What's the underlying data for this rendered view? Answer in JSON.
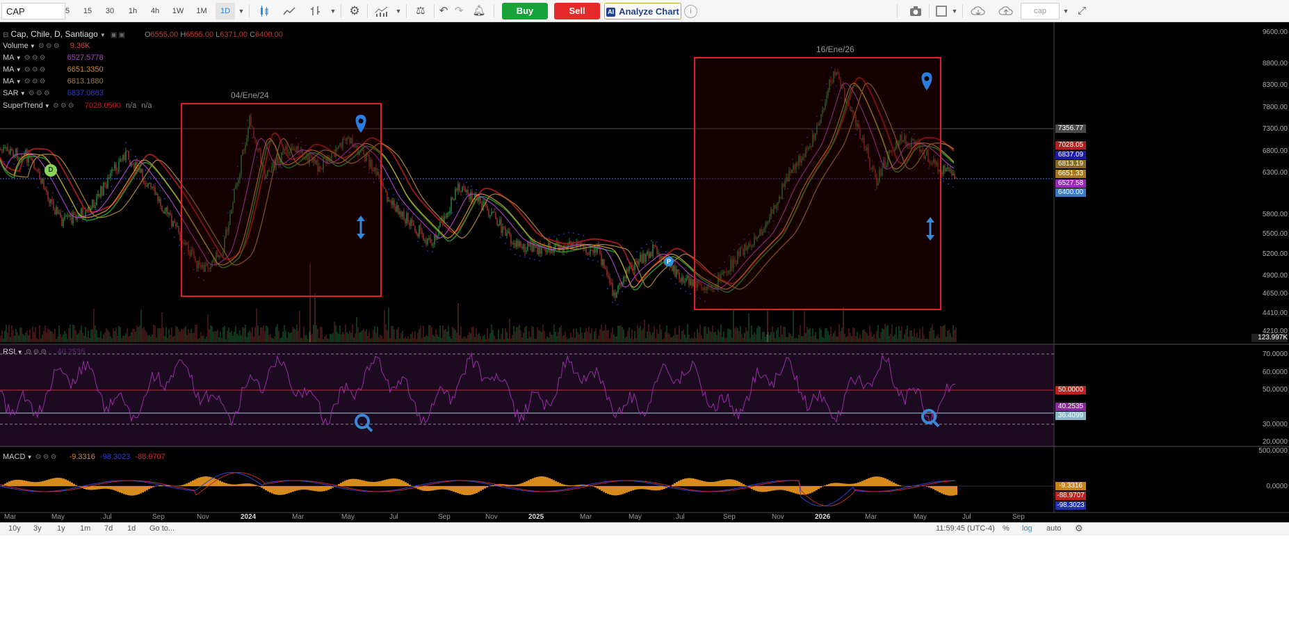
{
  "toolbar": {
    "symbol": "CAP",
    "intervals": [
      "5",
      "15",
      "30",
      "1h",
      "4h",
      "1W",
      "1M",
      "1D"
    ],
    "active_interval": "1D",
    "buy_label": "Buy",
    "sell_label": "Sell",
    "analyze_label": "Analyze Chart",
    "ai_badge": "AI",
    "search_placeholder": "cap",
    "info_icon": "i"
  },
  "legend": {
    "main": {
      "name": "Cap, Chile, D, Santiago",
      "o_label": "O",
      "o": "6555.00",
      "h_label": "H",
      "h": "6555.00",
      "l_label": "L",
      "l": "6371.00",
      "c_label": "C",
      "c": "6400.00"
    },
    "volume": {
      "name": "Volume",
      "value": "9.36K"
    },
    "ma1": {
      "name": "MA",
      "value": "6527.5778"
    },
    "ma2": {
      "name": "MA",
      "value": "6651.3350"
    },
    "ma3": {
      "name": "MA",
      "value": "6813.1880"
    },
    "sar": {
      "name": "SAR",
      "value": "6837.0883"
    },
    "supertrend": {
      "name": "SuperTrend",
      "value": "7028.0500",
      "v2": "n/a",
      "v3": "n/a"
    },
    "rsi": {
      "name": "RSI",
      "value": "40.2535"
    },
    "macd": {
      "name": "MACD",
      "v1": "-9.3316",
      "v2": "-98.3023",
      "v3": "-88.9707"
    }
  },
  "annotations": {
    "box1_date": "04/Ene/24",
    "box2_date": "16/Ene/26",
    "marker_d": "D",
    "marker_p": "P"
  },
  "price_axis": [
    "9600.00",
    "8800.00",
    "8300.00",
    "7800.00",
    "7300.00",
    "6800.00",
    "6300.00",
    "5800.00",
    "5500.00",
    "5200.00",
    "4900.00",
    "4650.00",
    "4410.00",
    "4210.00"
  ],
  "price_tags": [
    {
      "text": "7356.77",
      "color": "#4a4a4a"
    },
    {
      "text": "7028.05",
      "color": "#b02020"
    },
    {
      "text": "6837.09",
      "color": "#1c1ca8"
    },
    {
      "text": "6813.19",
      "color": "#8a6a22"
    },
    {
      "text": "6651.33",
      "color": "#a8781e"
    },
    {
      "text": "6527.58",
      "color": "#9a2ab0"
    },
    {
      "text": "6400.00",
      "color": "#3a78c8"
    }
  ],
  "volume_tag": "123.997K",
  "rsi_axis": [
    "70.0000",
    "60.0000",
    "50.0000",
    "30.0000",
    "20.0000"
  ],
  "rsi_tags": [
    {
      "text": "50.0000",
      "color": "#c02020"
    },
    {
      "text": "40.2535",
      "color": "#8a2a9a"
    },
    {
      "text": "36.4099",
      "color": "#8ab8c8"
    }
  ],
  "macd_axis": [
    "500.0000",
    "0.0000"
  ],
  "macd_tags": [
    {
      "text": "-9.3316",
      "color": "#c8821c"
    },
    {
      "text": "-88.9707",
      "color": "#c02020"
    },
    {
      "text": "-98.3023",
      "color": "#2030b0"
    }
  ],
  "time_axis": [
    "Mar",
    "May",
    "Jul",
    "Sep",
    "Nov",
    "2024",
    "Mar",
    "May",
    "Jul",
    "Sep",
    "Nov",
    "2025",
    "Mar",
    "May",
    "Jul",
    "Sep",
    "Nov",
    "2026",
    "Mar",
    "May",
    "Jul",
    "Sep"
  ],
  "bottom": {
    "ranges": [
      "10y",
      "3y",
      "1y",
      "1m",
      "7d",
      "1d"
    ],
    "goto": "Go to...",
    "clock": "11:59:45 (UTC-4)",
    "pct": "%",
    "log": "log",
    "auto": "auto"
  },
  "icons": [
    "candles-icon",
    "line-chart-icon",
    "bars-icon",
    "gear-icon",
    "indicators-icon",
    "compare-icon",
    "undo-icon",
    "redo-icon",
    "alert-icon",
    "camera-icon",
    "layout-icon",
    "cloud-download-icon",
    "cloud-upload-icon",
    "fullscreen-icon"
  ],
  "colors": {
    "box": "#e02020",
    "rsi_band": "#1f0a24",
    "accent": "#2b8ed8"
  }
}
